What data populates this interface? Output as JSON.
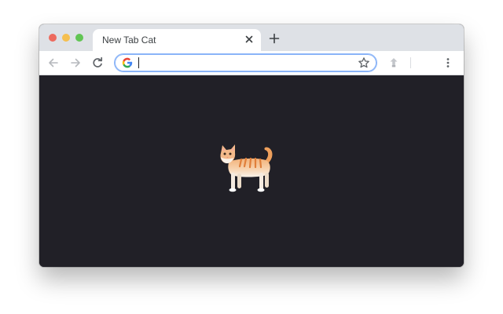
{
  "window": {
    "controls": {
      "close_color": "#ed6a5e",
      "minimize_color": "#f5bf4f",
      "zoom_color": "#61c554"
    }
  },
  "tabs": [
    {
      "title": "New Tab Cat",
      "active": true
    }
  ],
  "toolbar": {
    "omnibox": {
      "value": "",
      "placeholder": "",
      "search_engine_icon": "google-g-icon"
    },
    "icons": [
      "back-arrow-icon",
      "forward-arrow-icon",
      "reload-icon",
      "star-icon",
      "extension-icon",
      "kebab-menu-icon"
    ]
  },
  "content": {
    "background": "#212027",
    "emoji": "cat-icon"
  },
  "colors": {
    "tabstrip": "#dee1e6",
    "omnibox_focus": "#8ab4f8"
  }
}
